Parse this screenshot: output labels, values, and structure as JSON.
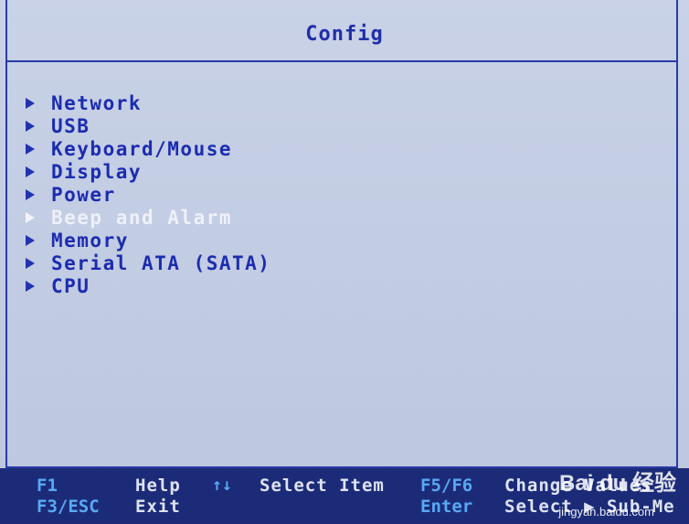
{
  "header": {
    "title": "Config"
  },
  "menu": {
    "items": [
      {
        "label": "Network",
        "selected": false
      },
      {
        "label": "USB",
        "selected": false
      },
      {
        "label": "Keyboard/Mouse",
        "selected": false
      },
      {
        "label": "Display",
        "selected": false
      },
      {
        "label": "Power",
        "selected": false
      },
      {
        "label": "Beep and Alarm",
        "selected": true
      },
      {
        "label": "Memory",
        "selected": false
      },
      {
        "label": "Serial ATA (SATA)",
        "selected": false
      },
      {
        "label": "CPU",
        "selected": false
      }
    ]
  },
  "footer": {
    "f1_key": "F1",
    "f1_desc": "Help",
    "arrows_key": "↑↓",
    "arrows_desc": "Select Item",
    "f5f6_key": "F5/F6",
    "f5f6_desc": "Change Values",
    "f3esc_key": "F3/ESC",
    "f3esc_desc": "Exit",
    "enter_key": "Enter",
    "enter_desc": "Select ▶ Sub-Me"
  },
  "watermark": {
    "text": "Bai du 经验",
    "url": "jingyan.baidu.com"
  },
  "colors": {
    "background": "#c5cee4",
    "frame": "#2a3aa8",
    "text": "#1c2cb0",
    "selected_text": "#eef1fb",
    "footer_bg": "#1c2b78",
    "footer_key": "#58a9f2"
  }
}
